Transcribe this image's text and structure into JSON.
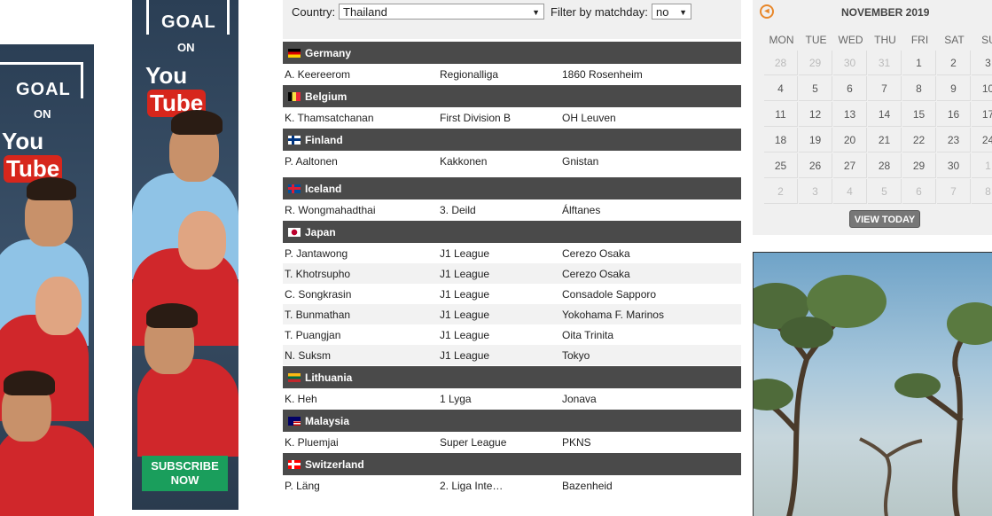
{
  "ads": {
    "left": {
      "goal": "GOAL",
      "on": "ON",
      "you": "You",
      "tube": "Tube"
    },
    "right": {
      "goal": "GOAL",
      "on": "ON",
      "you": "You",
      "tube": "Tube",
      "subscribe_line1": "SUBSCRIBE",
      "subscribe_line2": "NOW"
    }
  },
  "filters": {
    "country_label": "Country:",
    "country_value": "Thailand",
    "matchday_label": "Filter by matchday:",
    "matchday_value": "no"
  },
  "groups": [
    {
      "country": "Germany",
      "flag": [
        "#000000",
        "#dd0000",
        "#ffce00"
      ],
      "rows": [
        [
          "A. Keereerom",
          "Regionalliga",
          "1860 Rosenheim"
        ]
      ]
    },
    {
      "country": "Belgium",
      "flag": [
        "#000000",
        "#fae042",
        "#ed2939"
      ],
      "rows": [
        [
          "K. Thamsatchanan",
          "First Division B",
          "OH Leuven"
        ]
      ]
    },
    {
      "country": "Finland",
      "flag": [
        "#ffffff",
        "#003580"
      ],
      "rows": [
        [
          "P. Aaltonen",
          "Kakkonen",
          "Gnistan"
        ]
      ]
    },
    {
      "country": "Iceland",
      "flag": [
        "#02529c",
        "#dc1e35"
      ],
      "rows": [
        [
          "R. Wongmahadthai",
          "3. Deild",
          "Álftanes"
        ]
      ]
    },
    {
      "country": "Japan",
      "flag": [
        "#ffffff",
        "#bc002d"
      ],
      "rows": [
        [
          "P. Jantawong",
          "J1 League",
          "Cerezo Osaka"
        ],
        [
          "T. Khotrsupho",
          "J1 League",
          "Cerezo Osaka"
        ],
        [
          "C. Songkrasin",
          "J1 League",
          "Consadole Sapporo"
        ],
        [
          "T. Bunmathan",
          "J1 League",
          "Yokohama F. Marinos"
        ],
        [
          "T. Puangjan",
          "J1 League",
          "Oita Trinita"
        ],
        [
          "N. Suksm",
          "J1 League",
          "Tokyo"
        ]
      ]
    },
    {
      "country": "Lithuania",
      "flag": [
        "#fdb913",
        "#006a44",
        "#c1272d"
      ],
      "rows": [
        [
          "K. Heh",
          "1 Lyga",
          "Jonava"
        ]
      ]
    },
    {
      "country": "Malaysia",
      "flag": [
        "#cc0001",
        "#ffffff",
        "#010066"
      ],
      "rows": [
        [
          "K. Pluemjai",
          "Super League",
          "PKNS"
        ]
      ]
    },
    {
      "country": "Switzerland",
      "flag": [
        "#ff0000",
        "#ffffff"
      ],
      "rows": [
        [
          "P. Läng",
          "2. Liga Inte…",
          "Bazenheid"
        ]
      ]
    }
  ],
  "calendar": {
    "title": "NOVEMBER 2019",
    "days_of_week": [
      "MON",
      "TUE",
      "WED",
      "THU",
      "FRI",
      "SAT",
      "SU"
    ],
    "weeks": [
      [
        "28",
        "29",
        "30",
        "31",
        "1",
        "2",
        "3"
      ],
      [
        "4",
        "5",
        "6",
        "7",
        "8",
        "9",
        "10"
      ],
      [
        "11",
        "12",
        "13",
        "14",
        "15",
        "16",
        "17"
      ],
      [
        "18",
        "19",
        "20",
        "21",
        "22",
        "23",
        "24"
      ],
      [
        "25",
        "26",
        "27",
        "28",
        "29",
        "30",
        "1"
      ],
      [
        "2",
        "3",
        "4",
        "5",
        "6",
        "7",
        "8"
      ]
    ],
    "other_month": [
      [
        0,
        0
      ],
      [
        0,
        1
      ],
      [
        0,
        2
      ],
      [
        0,
        3
      ],
      [
        4,
        6
      ],
      [
        5,
        0
      ],
      [
        5,
        1
      ],
      [
        5,
        2
      ],
      [
        5,
        3
      ],
      [
        5,
        4
      ],
      [
        5,
        5
      ],
      [
        5,
        6
      ]
    ],
    "view_today": "VIEW TODAY"
  }
}
